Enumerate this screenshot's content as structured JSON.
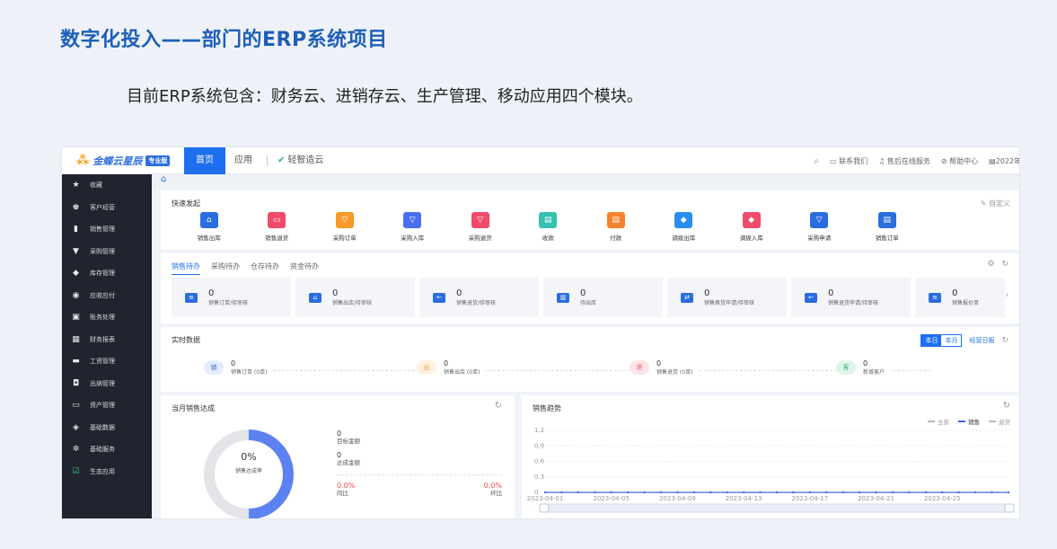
{
  "slide": {
    "title": "数字化投入——部门的ERP系统项目",
    "subtitle": "目前ERP系统包含：财务云、进销存云、生产管理、移动应用四个模块。"
  },
  "app": {
    "logo_text": "金蝶云星辰",
    "logo_badge": "专业版",
    "nav": {
      "home": "首页",
      "apps": "应用",
      "cloud": "轻智造云"
    },
    "top_right": {
      "contact": "联系我们",
      "support": "售后在线服务",
      "help": "帮助中心",
      "date": "2022年"
    }
  },
  "sidebar": {
    "items": [
      {
        "label": "收藏",
        "icon": "star-icon"
      },
      {
        "label": "客户经营",
        "icon": "users-icon"
      },
      {
        "label": "销售管理",
        "icon": "bar-chart-icon"
      },
      {
        "label": "采购管理",
        "icon": "cart-icon"
      },
      {
        "label": "库存管理",
        "icon": "box-icon"
      },
      {
        "label": "应收应付",
        "icon": "coin-icon"
      },
      {
        "label": "账务处理",
        "icon": "ledger-icon"
      },
      {
        "label": "财务报表",
        "icon": "report-icon"
      },
      {
        "label": "工资管理",
        "icon": "wallet-icon"
      },
      {
        "label": "出纳管理",
        "icon": "cashier-icon"
      },
      {
        "label": "资产管理",
        "icon": "asset-icon"
      },
      {
        "label": "基础数据",
        "icon": "database-icon"
      },
      {
        "label": "基础服务",
        "icon": "gear-icon"
      },
      {
        "label": "生态应用",
        "icon": "check-circle-icon"
      }
    ]
  },
  "quick_start": {
    "title": "快速发起",
    "custom": "自定义",
    "items": [
      {
        "label": "销售出库",
        "color": "#2a6de0",
        "icon": "home-icon"
      },
      {
        "label": "销售退货",
        "color": "#f04b6a",
        "icon": "return-icon"
      },
      {
        "label": "采购订单",
        "color": "#f59a2b",
        "icon": "cart-icon"
      },
      {
        "label": "采购入库",
        "color": "#4a6ef0",
        "icon": "cart-icon"
      },
      {
        "label": "采购退货",
        "color": "#f04b6a",
        "icon": "cart-icon"
      },
      {
        "label": "收款",
        "color": "#35c2b0",
        "icon": "card-icon"
      },
      {
        "label": "付款",
        "color": "#f5832b",
        "icon": "card-icon"
      },
      {
        "label": "调拨出库",
        "color": "#2a8ef0",
        "icon": "transfer-icon"
      },
      {
        "label": "调拨入库",
        "color": "#f04b6a",
        "icon": "transfer-icon"
      },
      {
        "label": "采购申请",
        "color": "#2a6de0",
        "icon": "cart-icon"
      },
      {
        "label": "销售订单",
        "color": "#2a6de0",
        "icon": "doc-icon"
      }
    ]
  },
  "pending": {
    "tabs": [
      "销售待办",
      "采购待办",
      "仓存待办",
      "资金待办"
    ],
    "items": [
      {
        "count": "0",
        "label": "销售订单/待审核"
      },
      {
        "count": "0",
        "label": "销售出库/待审核"
      },
      {
        "count": "0",
        "label": "销售退货/待审核"
      },
      {
        "count": "0",
        "label": "待出库"
      },
      {
        "count": "0",
        "label": "销售换货申请/待审核"
      },
      {
        "count": "0",
        "label": "销售退货申请/待审核"
      },
      {
        "count": "0",
        "label": "销售报价单"
      }
    ]
  },
  "realtime": {
    "title": "实时数据",
    "toggle": {
      "today": "本日",
      "month": "本月"
    },
    "daily_report": "经营日报",
    "items": [
      {
        "badge": "销",
        "value": "0",
        "label": "销售订单 (0单)",
        "bg": "#e4edfd",
        "fg": "#2a6de0"
      },
      {
        "badge": "出",
        "value": "0",
        "label": "销售出库 (0单)",
        "bg": "#fdf1e0",
        "fg": "#f59a2b"
      },
      {
        "badge": "退",
        "value": "0",
        "label": "销售退货 (0单)",
        "bg": "#fde4e8",
        "fg": "#f04b6a"
      },
      {
        "badge": "客",
        "value": "0",
        "label": "新增客户",
        "bg": "#e0f5ea",
        "fg": "#2eb872"
      }
    ]
  },
  "monthly_target": {
    "title": "当月销售达成",
    "rate_value": "0%",
    "rate_label": "销售达成率",
    "target_value": "0",
    "target_label": "目标金额",
    "achieved_value": "0",
    "achieved_label": "达成金额",
    "yoy_value": "0.0%",
    "yoy_label": "同比",
    "mom_value": "0.0%",
    "mom_label": "环比"
  },
  "sales_trend": {
    "title": "销售趋势",
    "legend": {
      "all": "全部",
      "sales": "销售",
      "returns": "退货"
    }
  },
  "chart_data": {
    "type": "line",
    "title": "销售趋势",
    "x_ticks": [
      "2023-04-01",
      "2023-04-05",
      "2023-04-09",
      "2023-04-13",
      "2023-04-17",
      "2023-04-21",
      "2023-04-25"
    ],
    "y_ticks": [
      0,
      0.3,
      0.6,
      0.9,
      1.2
    ],
    "ylim": [
      0,
      1.2
    ],
    "series": [
      {
        "name": "销售",
        "color": "#3b6cf0",
        "x_start": "2023-04-01",
        "count": 29,
        "values": [
          0,
          0,
          0,
          0,
          0,
          0,
          0,
          0,
          0,
          0,
          0,
          0,
          0,
          0,
          0,
          0,
          0,
          0,
          0,
          0,
          0,
          0,
          0,
          0,
          0,
          0,
          0,
          0,
          0
        ]
      }
    ],
    "grid": true,
    "legend_position": "top-right"
  }
}
